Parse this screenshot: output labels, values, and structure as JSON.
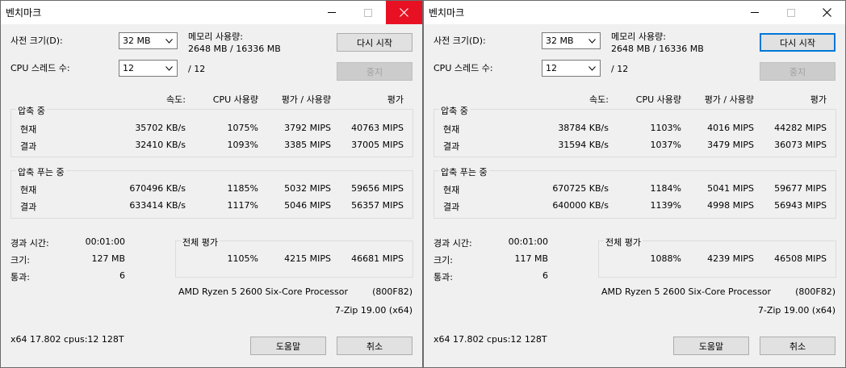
{
  "windows": [
    {
      "title": "벤치마크",
      "close_red": true,
      "dict_label": "사전 크기(D):",
      "dict_value": "32 MB",
      "mem_label": "메모리 사용량:",
      "mem_value": "2648 MB / 16336 MB",
      "restart_label": "다시 시작",
      "threads_label": "CPU 스레드 수:",
      "threads_value": "12",
      "threads_max": "/ 12",
      "stop_label": "중지",
      "col_speed": "속도:",
      "col_cpu": "CPU 사용량",
      "col_rating_usage": "평가 / 사용량",
      "col_rating": "평가",
      "compress_title": "압축 중",
      "compress_current": [
        "현재",
        "35702 KB/s",
        "1075%",
        "3792 MIPS",
        "40763 MIPS"
      ],
      "compress_result": [
        "결과",
        "32410 KB/s",
        "1093%",
        "3385 MIPS",
        "37005 MIPS"
      ],
      "decompress_title": "압축 푸는 중",
      "decompress_current": [
        "현재",
        "670496 KB/s",
        "1185%",
        "5032 MIPS",
        "59656 MIPS"
      ],
      "decompress_result": [
        "결과",
        "633414 KB/s",
        "1117%",
        "5046 MIPS",
        "56357 MIPS"
      ],
      "elapsed_label": "경과 시간:",
      "elapsed_value": "00:01:00",
      "size_label": "크기:",
      "size_value": "127 MB",
      "passes_label": "통과:",
      "passes_value": "6",
      "total_title": "전체 평가",
      "total_cpu": "1105%",
      "total_rating_usage": "4215 MIPS",
      "total_rating": "46681 MIPS",
      "cpu_name": "AMD Ryzen 5 2600 Six-Core Processor",
      "cpu_id": "(800F82)",
      "version": "7-Zip 19.00 (x64)",
      "sysinfo": "x64 17.802 cpus:12 128T",
      "help_label": "도움말",
      "cancel_label": "취소"
    },
    {
      "title": "벤치마크",
      "close_red": false,
      "dict_label": "사전 크기(D):",
      "dict_value": "32 MB",
      "mem_label": "메모리 사용량:",
      "mem_value": "2648 MB / 16336 MB",
      "restart_label": "다시 시작",
      "threads_label": "CPU 스레드 수:",
      "threads_value": "12",
      "threads_max": "/ 12",
      "stop_label": "중지",
      "col_speed": "속도:",
      "col_cpu": "CPU 사용량",
      "col_rating_usage": "평가 / 사용량",
      "col_rating": "평가",
      "compress_title": "압축 중",
      "compress_current": [
        "현재",
        "38784 KB/s",
        "1103%",
        "4016 MIPS",
        "44282 MIPS"
      ],
      "compress_result": [
        "결과",
        "31594 KB/s",
        "1037%",
        "3479 MIPS",
        "36073 MIPS"
      ],
      "decompress_title": "압축 푸는 중",
      "decompress_current": [
        "현재",
        "670725 KB/s",
        "1184%",
        "5041 MIPS",
        "59677 MIPS"
      ],
      "decompress_result": [
        "결과",
        "640000 KB/s",
        "1139%",
        "4998 MIPS",
        "56943 MIPS"
      ],
      "elapsed_label": "경과 시간:",
      "elapsed_value": "00:01:00",
      "size_label": "크기:",
      "size_value": "117 MB",
      "passes_label": "통과:",
      "passes_value": "6",
      "total_title": "전체 평가",
      "total_cpu": "1088%",
      "total_rating_usage": "4239 MIPS",
      "total_rating": "46508 MIPS",
      "cpu_name": "AMD Ryzen 5 2600 Six-Core Processor",
      "cpu_id": "(800F82)",
      "version": "7-Zip 19.00 (x64)",
      "sysinfo": "x64 17.802 cpus:12 128T",
      "help_label": "도움말",
      "cancel_label": "취소"
    }
  ],
  "colors": {
    "dialog_bg": "#f0f0f0",
    "close_hover": "#e81123",
    "focus_border": "#0078d7"
  }
}
